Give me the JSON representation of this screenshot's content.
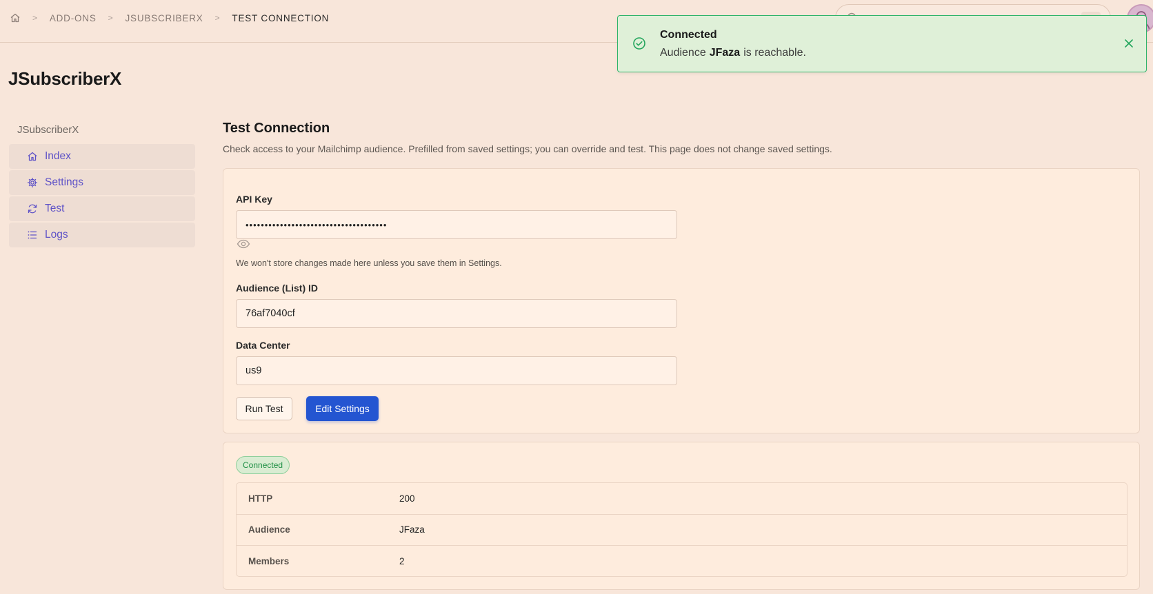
{
  "breadcrumb": {
    "items": [
      "ADD-ONS",
      "JSUBSCRIBERX",
      "TEST CONNECTION"
    ],
    "separator": ">"
  },
  "toast": {
    "title": "Connected",
    "message_prefix": "Audience",
    "audience_name": "JFaza",
    "message_suffix": "is reachable.",
    "status_color": "#22a55c"
  },
  "page": {
    "title": "JSubscriberX"
  },
  "sidebar": {
    "group_title": "JSubscriberX",
    "items": [
      {
        "label": "Index",
        "icon": "home-icon"
      },
      {
        "label": "Settings",
        "icon": "gear-icon"
      },
      {
        "label": "Test",
        "icon": "refresh-icon"
      },
      {
        "label": "Logs",
        "icon": "list-icon"
      }
    ],
    "accent_color": "#5e52c7"
  },
  "main": {
    "title": "Test Connection",
    "description": "Check access to your Mailchimp audience. Prefilled from saved settings; you can override and test. This page does not change saved settings."
  },
  "form": {
    "api_key": {
      "label": "API Key",
      "value": "•••••••••••••••••••••••••••••••••••••"
    },
    "hint": "We won't store changes made here unless you save them in Settings.",
    "audience_id": {
      "label": "Audience (List) ID",
      "value": "76af7040cf"
    },
    "data_center": {
      "label": "Data Center",
      "value": "us9"
    },
    "run_button": "Run Test",
    "edit_button": "Edit Settings",
    "primary_color": "#2455d1"
  },
  "result": {
    "status_badge": "Connected",
    "rows": [
      {
        "key": "HTTP",
        "value": "200"
      },
      {
        "key": "Audience",
        "value": "JFaza"
      },
      {
        "key": "Members",
        "value": "2"
      }
    ]
  }
}
